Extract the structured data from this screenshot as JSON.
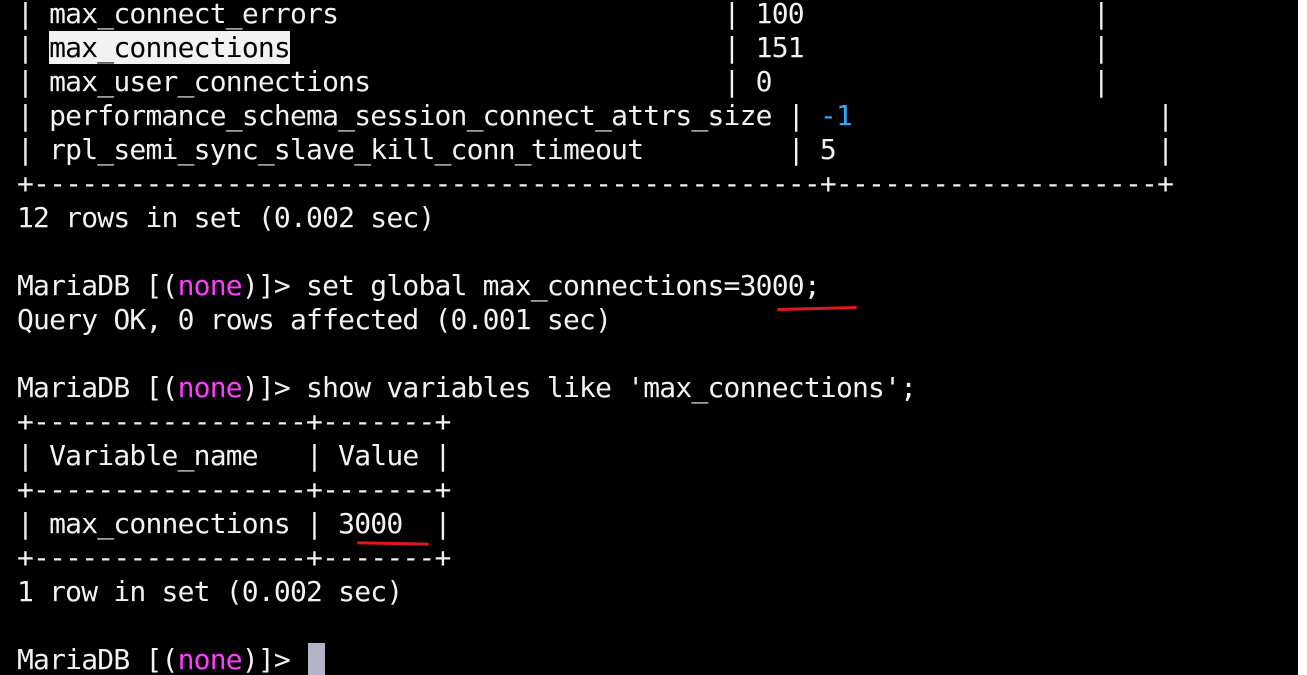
{
  "terminal": {
    "table1": {
      "rows": [
        [
          "| ",
          "max_connect_errors",
          "                        | ",
          "100",
          "                  |"
        ],
        [
          "| ",
          "max_connections",
          "                           | ",
          "151",
          "                  |"
        ],
        [
          "| ",
          "max_user_connections",
          "                      | ",
          "0",
          "                    |"
        ],
        [
          "| ",
          "performance_schema_session_connect_attrs_size",
          " | ",
          "-1",
          "                   |"
        ],
        [
          "| ",
          "rpl_semi_sync_slave_kill_conn_timeout",
          "         | ",
          "5",
          "                    |"
        ]
      ],
      "border": "+-------------------------------------------------+--------------------+",
      "result": "12 rows in set (0.002 sec)"
    },
    "prompt": {
      "prefix": "MariaDB [(",
      "db": "none",
      "suffix": ")]> "
    },
    "cmd1": {
      "text": "set global max_connections=",
      "value": "3000",
      "end": ";"
    },
    "cmd1_result": "Query OK, 0 rows affected (0.001 sec)",
    "cmd2": "show variables like 'max_connections';",
    "table2": {
      "border": "+-----------------+-------+",
      "header": "| Variable_name   | Value |",
      "row_prefix": "| max_connections | ",
      "row_value": "3000",
      "row_suffix": "  |",
      "result": "1 row in set (0.002 sec)"
    }
  }
}
